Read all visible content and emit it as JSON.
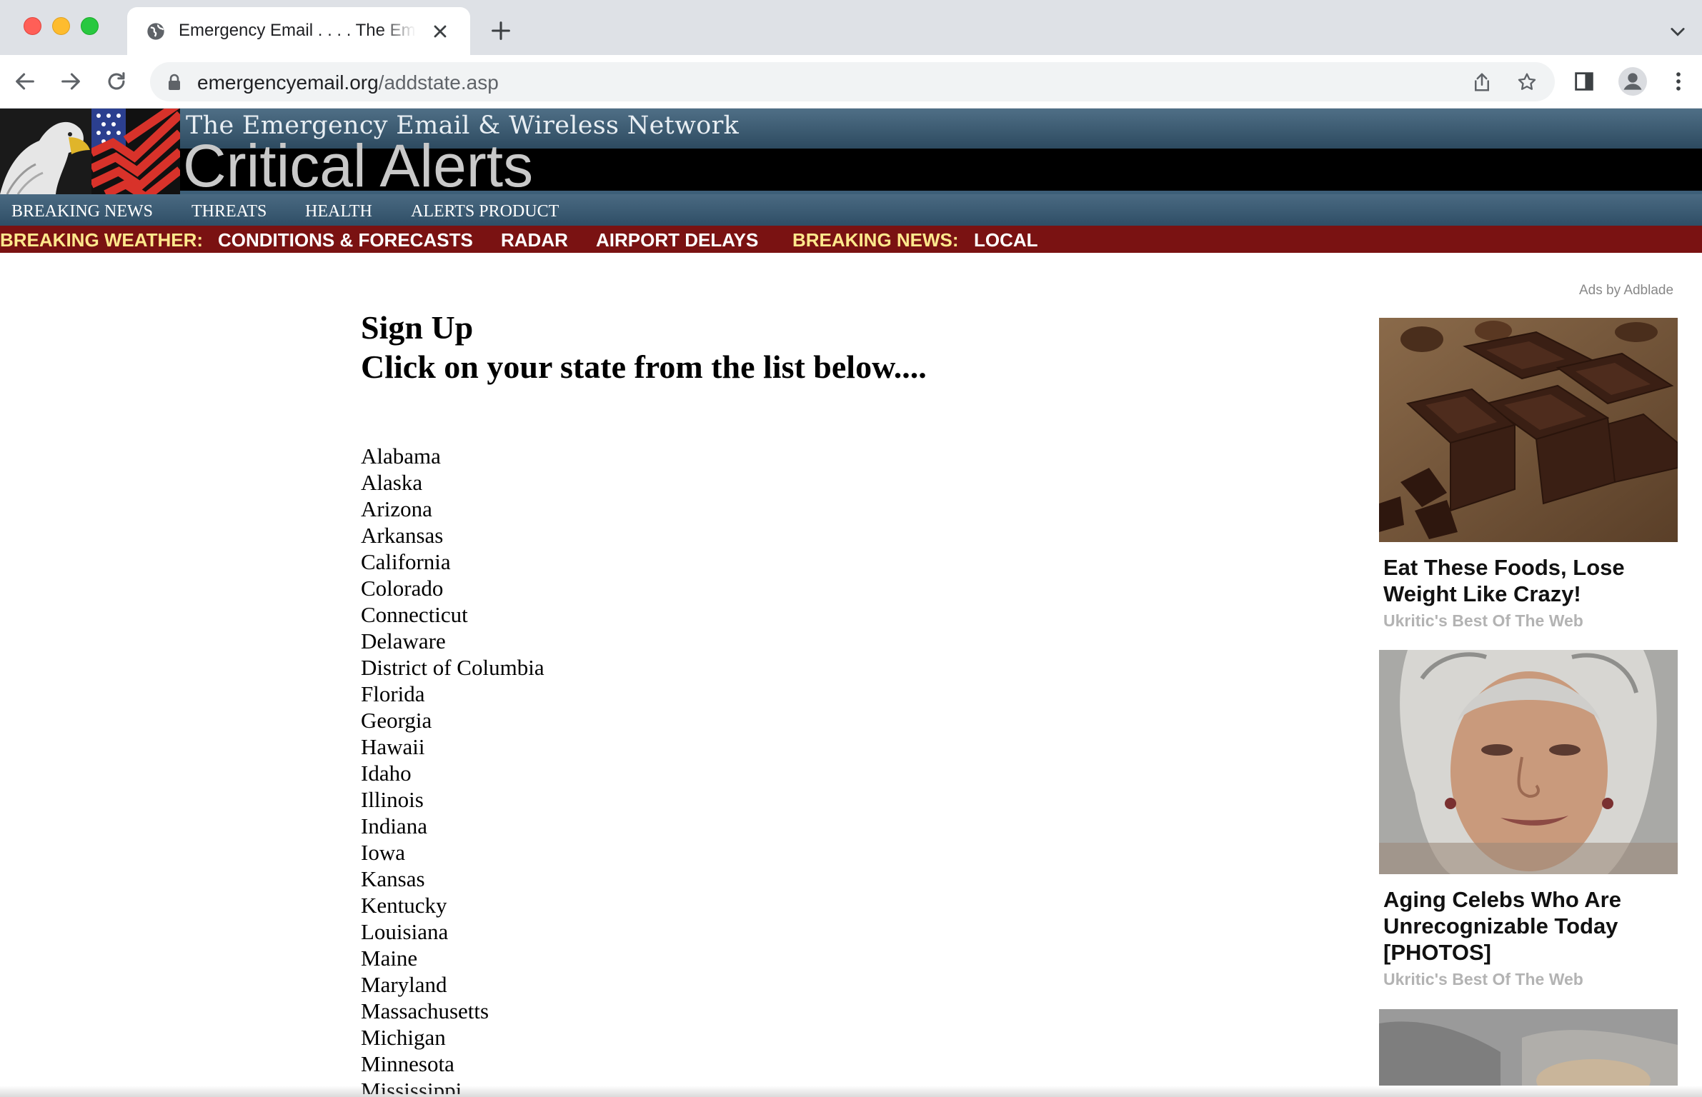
{
  "browser": {
    "tab": {
      "title": "Emergency Email . . . . The Emergency Email & Wireless Network"
    },
    "address": {
      "domain": "emergencyemail.org",
      "path": "/addstate.asp"
    }
  },
  "site": {
    "header": {
      "subtitle": "The Emergency Email & Wireless Network",
      "title": "Critical Alerts"
    },
    "main_nav": [
      "BREAKING NEWS",
      "THREATS",
      "HEALTH",
      "ALERTS PRODUCT"
    ],
    "sub_nav": {
      "weather_label": "BREAKING WEATHER:",
      "weather_links": [
        "CONDITIONS & FORECASTS",
        "RADAR",
        "AIRPORT DELAYS"
      ],
      "news_label": "BREAKING NEWS:",
      "news_links": [
        "LOCAL"
      ]
    }
  },
  "content": {
    "heading": "Sign Up",
    "instruction": "Click on your state from the list below....",
    "states": [
      "Alabama",
      "Alaska",
      "Arizona",
      "Arkansas",
      "California",
      "Colorado",
      "Connecticut",
      "Delaware",
      "District of Columbia",
      "Florida",
      "Georgia",
      "Hawaii",
      "Idaho",
      "Illinois",
      "Indiana",
      "Iowa",
      "Kansas",
      "Kentucky",
      "Louisiana",
      "Maine",
      "Maryland",
      "Massachusetts",
      "Michigan",
      "Minnesota",
      "Mississippi"
    ]
  },
  "ads": {
    "label": "Ads by Adblade",
    "items": [
      {
        "title": "Eat These Foods, Lose Weight Like Crazy!",
        "source": "Ukritic's Best Of The Web"
      },
      {
        "title": "Aging Celebs Who Are Unrecognizable Today [PHOTOS]",
        "source": "Ukritic's Best Of The Web"
      }
    ]
  },
  "colors": {
    "header_band": "#2d4a60",
    "sub_nav_bg": "#7a1212",
    "sub_nav_label": "#ffe88c"
  }
}
